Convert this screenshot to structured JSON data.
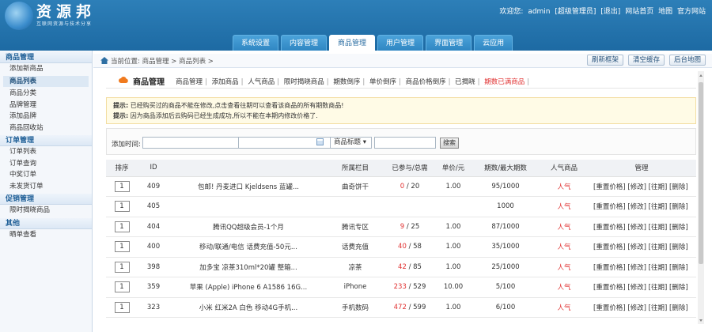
{
  "header": {
    "title": "资源邦",
    "tagline": "互联网资源与技术分享",
    "welcome": "欢迎您:",
    "user": "admin",
    "role": "[超级管理员]",
    "logout": "[退出]",
    "home_link": "网站首页",
    "map_link": "地图",
    "official_link": "官方网站",
    "tabs": [
      "系统设置",
      "内容管理",
      "商品管理",
      "用户管理",
      "界面管理",
      "云应用"
    ],
    "active_tab": "商品管理"
  },
  "sidebar": {
    "groups": [
      {
        "title": "商品管理",
        "items": [
          "添加新商品",
          "商品列表",
          "商品分类",
          "品牌管理",
          "添加品牌",
          "商品回收站"
        ]
      },
      {
        "title": "订单管理",
        "items": [
          "订单列表",
          "订单查询",
          "中奖订单",
          "未发货订单"
        ]
      },
      {
        "title": "促销管理",
        "items": [
          "限时揭晓商品"
        ]
      },
      {
        "title": "其他",
        "items": [
          "晒单查看"
        ]
      }
    ],
    "active_item": "商品列表"
  },
  "breadcrumb": {
    "text": "当前位置: 商品管理 > 商品列表 >",
    "buttons": [
      "刷新框架",
      "清空缓存",
      "后台地图"
    ]
  },
  "section": {
    "title": "商品管理",
    "links": [
      "商品管理",
      "添加商品",
      "人气商品",
      "限时揭晓商品",
      "期数倒序",
      "单价倒序",
      "商品价格倒序",
      "已揭晓",
      "期数已满商品"
    ],
    "highlight_link": "期数已满商品"
  },
  "notice": {
    "line1_label": "提示:",
    "line1": "已经购买过的商品不能在修改,点击查看往期可以查看该商品的所有期数商品!",
    "line2_label": "提示:",
    "line2": "因为商品添加后云购码已经生成成功,所以不能在本期内修改价格了."
  },
  "filter": {
    "label": "添加时间:",
    "dash": "-",
    "field": "商品标题 ▾",
    "search": "搜索"
  },
  "table": {
    "columns": [
      "排序",
      "ID",
      "",
      "所属栏目",
      "已参与/总需",
      "单价/元",
      "期数/最大期数",
      "人气商品",
      "管理"
    ],
    "rows": [
      {
        "sort": "1",
        "id": "409",
        "title": "包邮! 丹麦进口 Kjeldsens 蓝罐...",
        "category": "曲奇饼干",
        "joined": "0",
        "total": "/ 20",
        "price": "1.00",
        "periods": "95/1000",
        "hot": "人气",
        "manage": "[重置价格] [修改] [往期] [删除]"
      },
      {
        "sort": "1",
        "id": "405",
        "title": "",
        "category": "",
        "joined": "",
        "total": "",
        "price": "",
        "periods": "1000",
        "hot": "人气",
        "manage": "[重置价格] [修改] [往期] [删除]"
      },
      {
        "sort": "1",
        "id": "404",
        "title": "腾讯QQ超级会员-1个月",
        "category": "腾讯专区",
        "joined": "9",
        "total": "/ 25",
        "price": "1.00",
        "periods": "87/1000",
        "hot": "人气",
        "manage": "[重置价格] [修改] [往期] [删除]"
      },
      {
        "sort": "1",
        "id": "400",
        "title": "移动/联通/电信 话费充值-50元...",
        "category": "话费充值",
        "joined": "40",
        "total": "/ 58",
        "price": "1.00",
        "periods": "35/1000",
        "hot": "人气",
        "manage": "[重置价格] [修改] [往期] [删除]"
      },
      {
        "sort": "1",
        "id": "398",
        "title": "加多宝 凉茶310ml*20罐 整箱...",
        "category": "凉茶",
        "joined": "42",
        "total": "/ 85",
        "price": "1.00",
        "periods": "25/1000",
        "hot": "人气",
        "manage": "[重置价格] [修改] [往期] [删除]"
      },
      {
        "sort": "1",
        "id": "359",
        "title": "苹果 (Apple) iPhone 6 A1586 16G...",
        "category": "iPhone",
        "joined": "233",
        "total": "/ 529",
        "price": "10.00",
        "periods": "5/100",
        "hot": "人气",
        "manage": "[重置价格] [修改] [往期] [删除]"
      },
      {
        "sort": "1",
        "id": "323",
        "title": "小米 红米2A 白色 移动4G手机...",
        "category": "手机数码",
        "joined": "472",
        "total": "/ 599",
        "price": "1.00",
        "periods": "6/100",
        "hot": "人气",
        "manage": "[重置价格] [修改] [往期] [删除]"
      }
    ]
  },
  "colors": {
    "header": "#2d7fb8",
    "accent_red": "#e03030",
    "sidebar_group": "#1f5f97"
  }
}
